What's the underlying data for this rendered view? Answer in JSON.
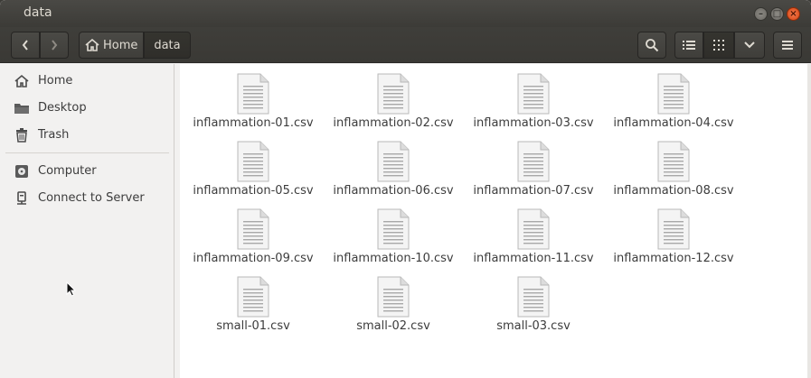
{
  "window": {
    "title": "data"
  },
  "toolbar": {
    "breadcrumb_home": "Home",
    "breadcrumb_current": "data"
  },
  "sidebar": {
    "items": [
      {
        "label": "Home",
        "icon": "home-icon"
      },
      {
        "label": "Desktop",
        "icon": "folder-icon"
      },
      {
        "label": "Trash",
        "icon": "trash-icon"
      },
      {
        "label": "Computer",
        "icon": "drive-icon"
      },
      {
        "label": "Connect to Server",
        "icon": "server-icon"
      }
    ]
  },
  "files": [
    {
      "name": "inflammation-01.csv"
    },
    {
      "name": "inflammation-02.csv"
    },
    {
      "name": "inflammation-03.csv"
    },
    {
      "name": "inflammation-04.csv"
    },
    {
      "name": "inflammation-05.csv"
    },
    {
      "name": "inflammation-06.csv"
    },
    {
      "name": "inflammation-07.csv"
    },
    {
      "name": "inflammation-08.csv"
    },
    {
      "name": "inflammation-09.csv"
    },
    {
      "name": "inflammation-10.csv"
    },
    {
      "name": "inflammation-11.csv"
    },
    {
      "name": "inflammation-12.csv"
    },
    {
      "name": "small-01.csv"
    },
    {
      "name": "small-02.csv"
    },
    {
      "name": "small-03.csv"
    }
  ],
  "colors": {
    "chrome": "#3c3b37",
    "close_button": "#e95420",
    "content_bg": "#ffffff",
    "sidebar_bg": "#f2f1f0"
  }
}
